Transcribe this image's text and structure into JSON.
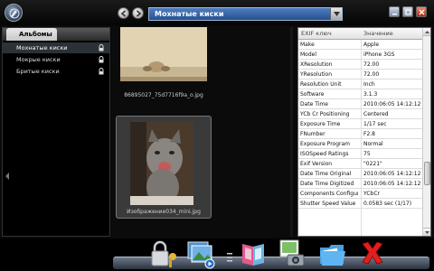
{
  "window": {
    "album_name": "Мохнатые киски"
  },
  "sidebar": {
    "title": "Альбомы",
    "items": [
      {
        "label": "Мохнатые киски",
        "active": true
      },
      {
        "label": "Мокрые киски",
        "active": false
      },
      {
        "label": "Бритые киски",
        "active": false
      }
    ]
  },
  "thumbnails": [
    {
      "caption": "86895027_75d7716f9a_o.jpg",
      "selected": false
    },
    {
      "caption": "Изображение034_mini.jpg",
      "selected": true
    }
  ],
  "exif": {
    "col_key": "EXIF ключ",
    "col_value": "Значение",
    "rows": [
      {
        "key": "Make",
        "value": "Apple"
      },
      {
        "key": "Model",
        "value": "iPhone 3GS"
      },
      {
        "key": "XResolution",
        "value": "72.00"
      },
      {
        "key": "YResolution",
        "value": "72.00"
      },
      {
        "key": "Resolution Unit",
        "value": "Inch"
      },
      {
        "key": "Software",
        "value": "3.1.3"
      },
      {
        "key": "Date Time",
        "value": "2010:06:05 14:12:12"
      },
      {
        "key": "YCb Cr Positioning",
        "value": "Centered"
      },
      {
        "key": "Exposure Time",
        "value": "1/17 sec"
      },
      {
        "key": "FNumber",
        "value": "F2.8"
      },
      {
        "key": "Exposure Program",
        "value": "Normal"
      },
      {
        "key": "ISOSpeed Ratings",
        "value": "75"
      },
      {
        "key": "Exif Version",
        "value": "\"0221\""
      },
      {
        "key": "Date Time Original",
        "value": "2010:06:05 14:12:12"
      },
      {
        "key": "Date Time Digitized",
        "value": "2010:06:05 14:12:12"
      },
      {
        "key": "Components Configur",
        "value": "YCbCr"
      },
      {
        "key": "Shutter Speed Value",
        "value": "0.0583 sec (1/17)"
      }
    ]
  },
  "dock": {
    "items": [
      "lock-key-icon",
      "slideshow-icon",
      "album-book-icon",
      "camera-photo-icon",
      "folder-icon",
      "delete-x-icon"
    ]
  },
  "colors": {
    "title_bar": "#25508f",
    "selected_row": "#2a3238",
    "delete": "#e02020"
  }
}
